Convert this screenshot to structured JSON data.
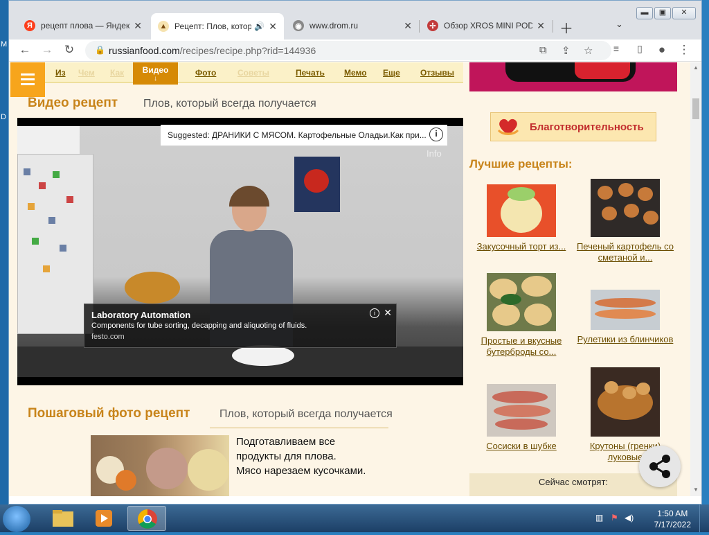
{
  "desktop": {
    "left_letters": [
      "M",
      "D"
    ]
  },
  "tabs": [
    {
      "title": "рецепт плова — Яндекс",
      "favicon": "yandex-icon",
      "active": false
    },
    {
      "title": "Рецепт: Плов, который",
      "favicon": "russianfood-icon",
      "active": true,
      "audio": true
    },
    {
      "title": "www.drom.ru",
      "favicon": "globe-icon",
      "active": false
    },
    {
      "title": "Обзор XROS MINI POD",
      "favicon": "ornament-icon",
      "active": false
    }
  ],
  "address": {
    "host": "russianfood.com",
    "path": "/recipes/recipe.php?rid=144936"
  },
  "nav": {
    "items": [
      "Из",
      "Чем",
      "Как"
    ],
    "video": "Видео",
    "video_arrow": "↓",
    "right_items": [
      "Фото",
      "Советы",
      "Печать",
      "Мемо",
      "Еще",
      "Отзывы"
    ]
  },
  "video_section": {
    "heading": "Видео рецепт",
    "subtitle": "Плов, который всегда получается",
    "suggested": "Suggested: ДРАНИКИ С МЯСОМ. Картофельные Оладьи.Как при...",
    "info_label": "Info",
    "ad": {
      "title": "Laboratory Automation",
      "desc": "Components for tube sorting, decapping and aliquoting of fluids.",
      "url": "festo.com"
    }
  },
  "step_section": {
    "heading": "Пошаговый фото рецепт",
    "subtitle": "Плов, который всегда получается",
    "text_lines": [
      "Подготавливаем все",
      "продукты для плова.",
      "Мясо нарезаем кусочками."
    ]
  },
  "sidebar": {
    "charity": "Благотворительность",
    "best_heading": "Лучшие рецепты:",
    "recipes": [
      {
        "caption": "Закусочный торт из..."
      },
      {
        "caption": "Печеный картофель со сметаной и..."
      },
      {
        "caption": "Простые и вкусные бутерброды со..."
      },
      {
        "caption": "Рулетики из блинчиков"
      },
      {
        "caption": "Сосиски в шубке"
      },
      {
        "caption": "Крутоны (гренки) луковые"
      }
    ],
    "watching": "Сейчас смотрят:"
  },
  "taskbar": {
    "time": "1:50 AM",
    "date": "7/17/2022",
    "apps": [
      "explorer-icon",
      "media-player-icon",
      "chrome-icon"
    ]
  },
  "colors": {
    "accent": "#c8841a",
    "nav_active": "#d68a06",
    "page_bg": "#fdf5e6"
  }
}
